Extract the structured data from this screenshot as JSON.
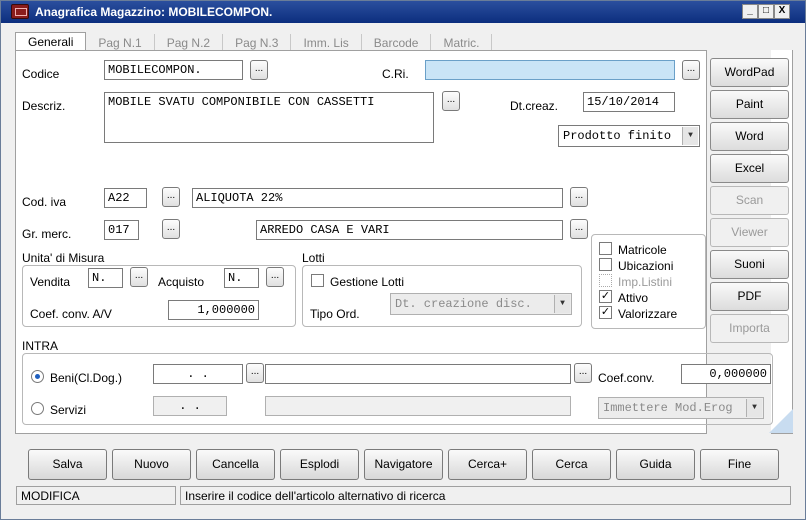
{
  "window": {
    "title": "Anagrafica Magazzino: MOBILECOMPON."
  },
  "titlebar_buttons": [
    "_",
    "□",
    "X"
  ],
  "tabs": [
    "Generali",
    "Pag N.1",
    "Pag N.2",
    "Pag N.3",
    "Imm. Lis",
    "Barcode",
    "Matric."
  ],
  "form": {
    "codice_label": "Codice",
    "codice": "MOBILECOMPON.",
    "cri_label": "C.Ri.",
    "cri": "",
    "descriz_label": "Descriz.",
    "descriz": "MOBILE SVATU COMPONIBILE CON CASSETTI",
    "dtcreaz_label": "Dt.creaz.",
    "dtcreaz": "15/10/2014",
    "tipo": "Prodotto finito",
    "codiva_label": "Cod. iva",
    "codiva": "A22",
    "codiva_desc": "ALIQUOTA 22%",
    "grmerc_label": "Gr. merc.",
    "grmerc": "017",
    "grmerc_desc": "ARREDO CASA E VARI",
    "dots": "..."
  },
  "um": {
    "title": "Unita' di Misura",
    "vendita_label": "Vendita",
    "vendita": "N.",
    "acquisto_label": "Acquisto",
    "acquisto": "N.",
    "coef_label": "Coef. conv. A/V",
    "coef": "1,000000"
  },
  "lotti": {
    "title": "Lotti",
    "gestione_label": "Gestione Lotti",
    "tipo_ord_label": "Tipo Ord.",
    "tipo_ord": "Dt. creazione disc."
  },
  "checks": [
    {
      "label": "Matricole",
      "checked": false,
      "disabled": false
    },
    {
      "label": "Ubicazioni",
      "checked": false,
      "disabled": false
    },
    {
      "label": "Imp.Listini",
      "checked": false,
      "disabled": true
    },
    {
      "label": "Attivo",
      "checked": true,
      "disabled": false
    },
    {
      "label": "Valorizzare",
      "checked": true,
      "disabled": false
    }
  ],
  "intra": {
    "title": "INTRA",
    "beni_label": "Beni(Cl.Dog.)",
    "beni": ". .",
    "servizi_label": "Servizi",
    "servizi": ". .",
    "coef_label": "Coef.conv.",
    "coef": "0,000000",
    "mod_erog": "Immettere Mod.Erog"
  },
  "side_buttons": [
    {
      "label": "WordPad",
      "disabled": false
    },
    {
      "label": "Paint",
      "disabled": false
    },
    {
      "label": "Word",
      "disabled": false
    },
    {
      "label": "Excel",
      "disabled": false
    },
    {
      "label": "Scan",
      "disabled": true
    },
    {
      "label": "Viewer",
      "disabled": true
    },
    {
      "label": "Suoni",
      "disabled": false
    },
    {
      "label": "PDF",
      "disabled": false
    },
    {
      "label": "Importa",
      "disabled": true
    }
  ],
  "bottom_buttons": [
    "Salva",
    "Nuovo",
    "Cancella",
    "Esplodi",
    "Navigatore",
    "Cerca+",
    "Cerca",
    "Guida",
    "Fine"
  ],
  "status": {
    "mode": "MODIFICA",
    "message": "Inserire il codice dell'articolo alternativo di ricerca"
  },
  "colors": {
    "title_bar": "#0c2e7e",
    "cri_field": "#c9e4f6",
    "radio_dot": "#1f5fbf"
  }
}
